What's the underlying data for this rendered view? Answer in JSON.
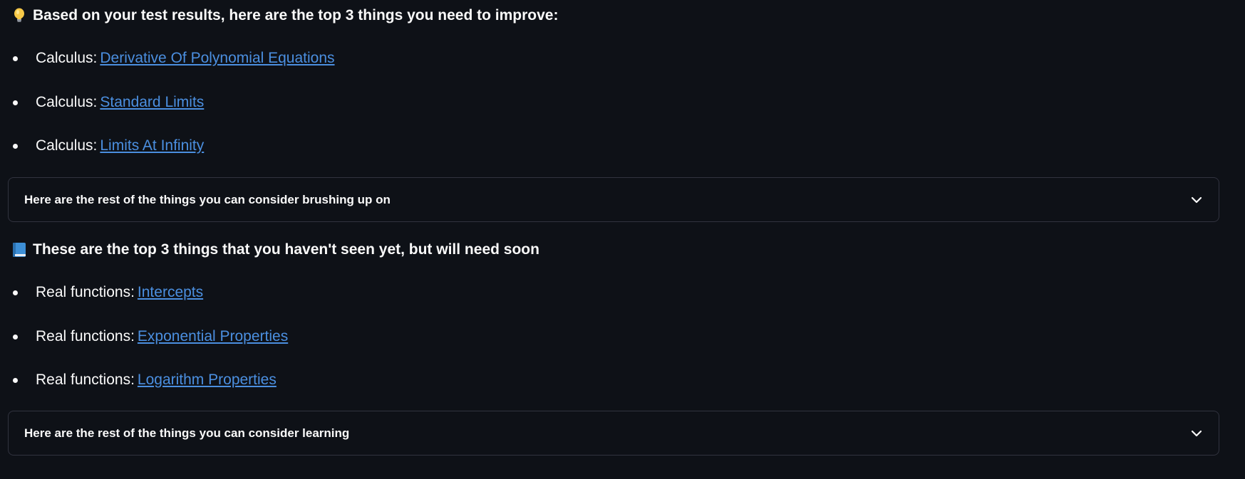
{
  "improve_section": {
    "icon": "lightbulb-icon",
    "heading": "Based on your test results, here are the top 3 things you need to improve:",
    "items": [
      {
        "prefix": "Calculus:",
        "link": "Derivative Of Polynomial Equations"
      },
      {
        "prefix": "Calculus:",
        "link": "Standard Limits"
      },
      {
        "prefix": "Calculus:",
        "link": "Limits At Infinity"
      }
    ],
    "expander_label": "Here are the rest of the things you can consider brushing up on"
  },
  "learn_section": {
    "icon": "blue-book-icon",
    "heading": "These are the top 3 things that you haven't seen yet, but will need soon",
    "items": [
      {
        "prefix": "Real functions:",
        "link": "Intercepts"
      },
      {
        "prefix": "Real functions:",
        "link": "Exponential Properties"
      },
      {
        "prefix": "Real functions:",
        "link": "Logarithm Properties"
      }
    ],
    "expander_label": "Here are the rest of the things you can consider learning"
  },
  "colors": {
    "background": "#0e1117",
    "text": "#fafafa",
    "link": "#4b8fe0",
    "border": "#31333f"
  }
}
